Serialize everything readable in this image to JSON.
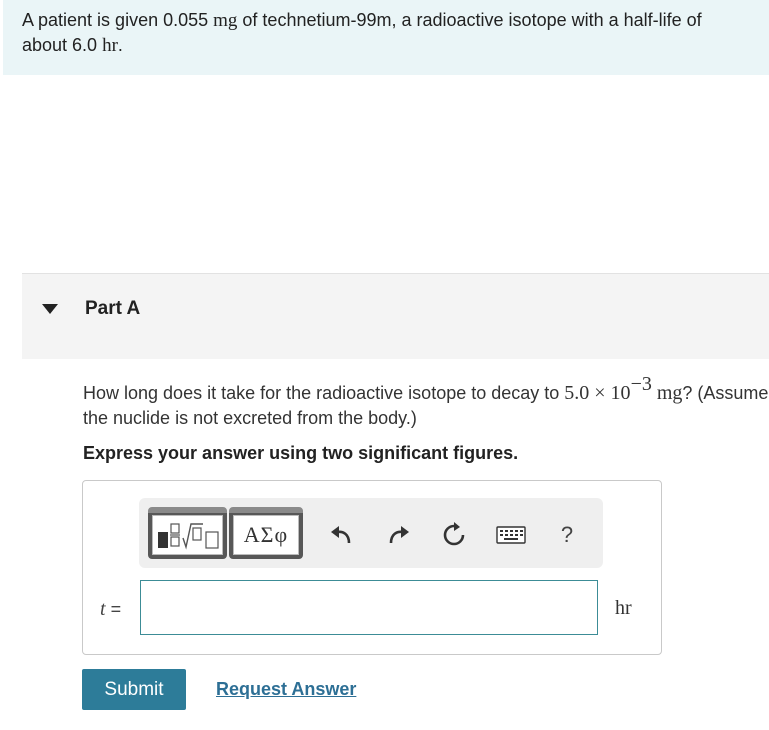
{
  "intro": {
    "text_before": "A patient is given 0.055 ",
    "mass_unit": "mg",
    "text_middle": " of technetium-99m, a radioactive isotope with a half-life of about 6.0 ",
    "time_unit": "hr",
    "text_end": "."
  },
  "part": {
    "title": "Part A",
    "question_before": "How long does it take for the radioactive isotope to decay to ",
    "question_math": "5.0 × 10",
    "question_exponent": "−3",
    "question_unit": " mg",
    "question_after": "? (Assume the nuclide is not excreted from the body.)",
    "instruction": "Express your answer using two significant figures."
  },
  "toolbar": {
    "templates_icon": "templates-icon",
    "greek_label": "ΑΣφ",
    "undo_icon": "undo-icon",
    "redo_icon": "redo-icon",
    "reset_icon": "reset-icon",
    "keyboard_icon": "keyboard-icon",
    "help_label": "?"
  },
  "answer": {
    "variable": "t",
    "equals": " =",
    "value": "",
    "unit": "hr"
  },
  "actions": {
    "submit_label": "Submit",
    "request_label": "Request Answer"
  },
  "colors": {
    "intro_bg": "#eaf5f7",
    "accent": "#2d7c99",
    "link": "#2d6f95",
    "input_border": "#3c8c96"
  }
}
